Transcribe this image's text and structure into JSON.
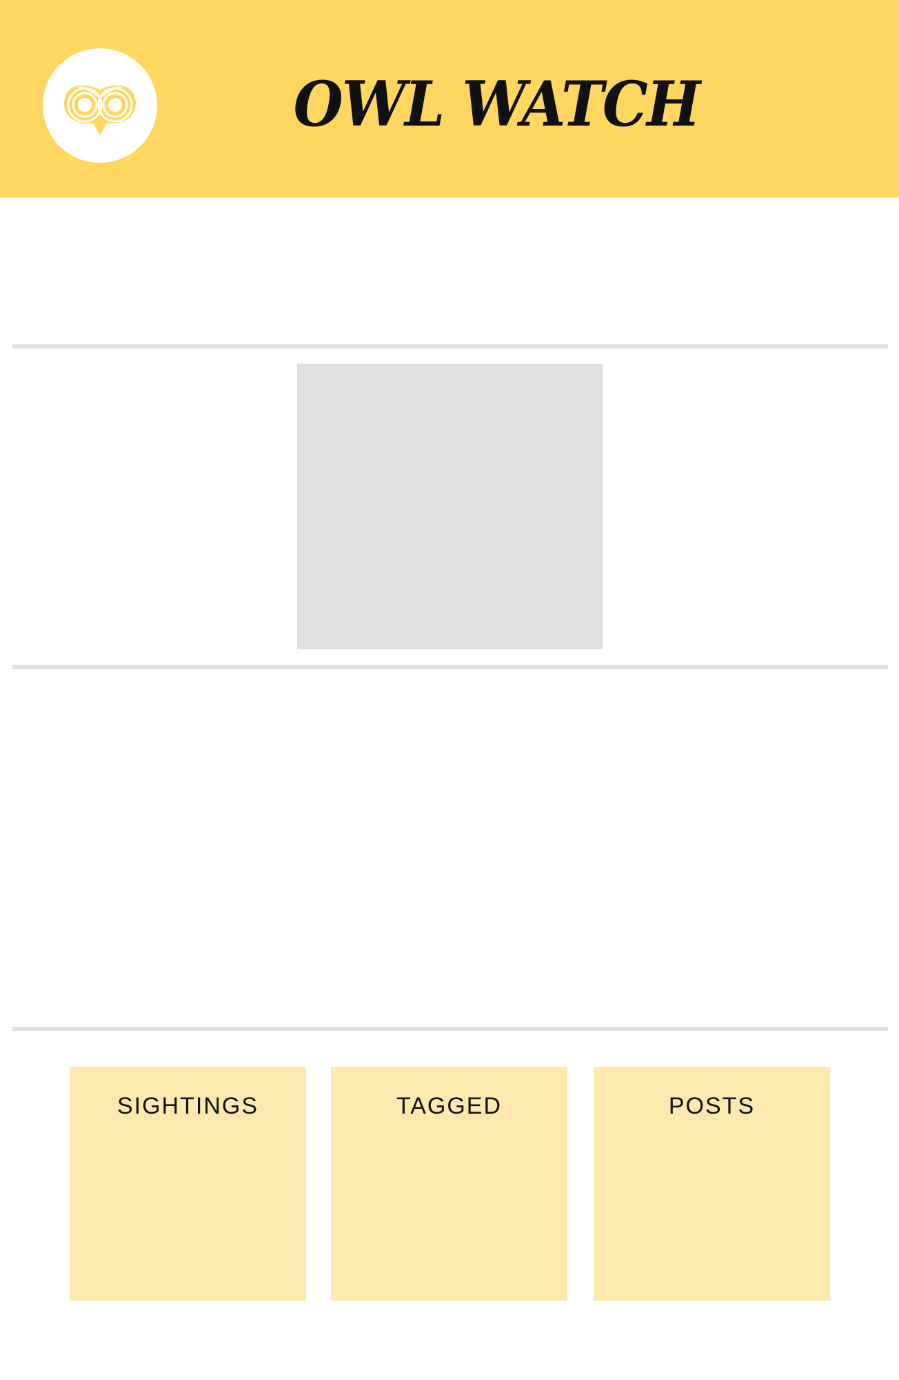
{
  "header": {
    "title": "OWL WATCH",
    "logo_icon": "owl-face-icon",
    "background_color": "#FED660"
  },
  "main": {
    "photo_placeholder_color": "#E0E0E0"
  },
  "stats": {
    "cards": [
      {
        "label": "SIGHTINGS"
      },
      {
        "label": "TAGGED"
      },
      {
        "label": "POSTS"
      }
    ],
    "card_color": "#FDE8AD"
  }
}
